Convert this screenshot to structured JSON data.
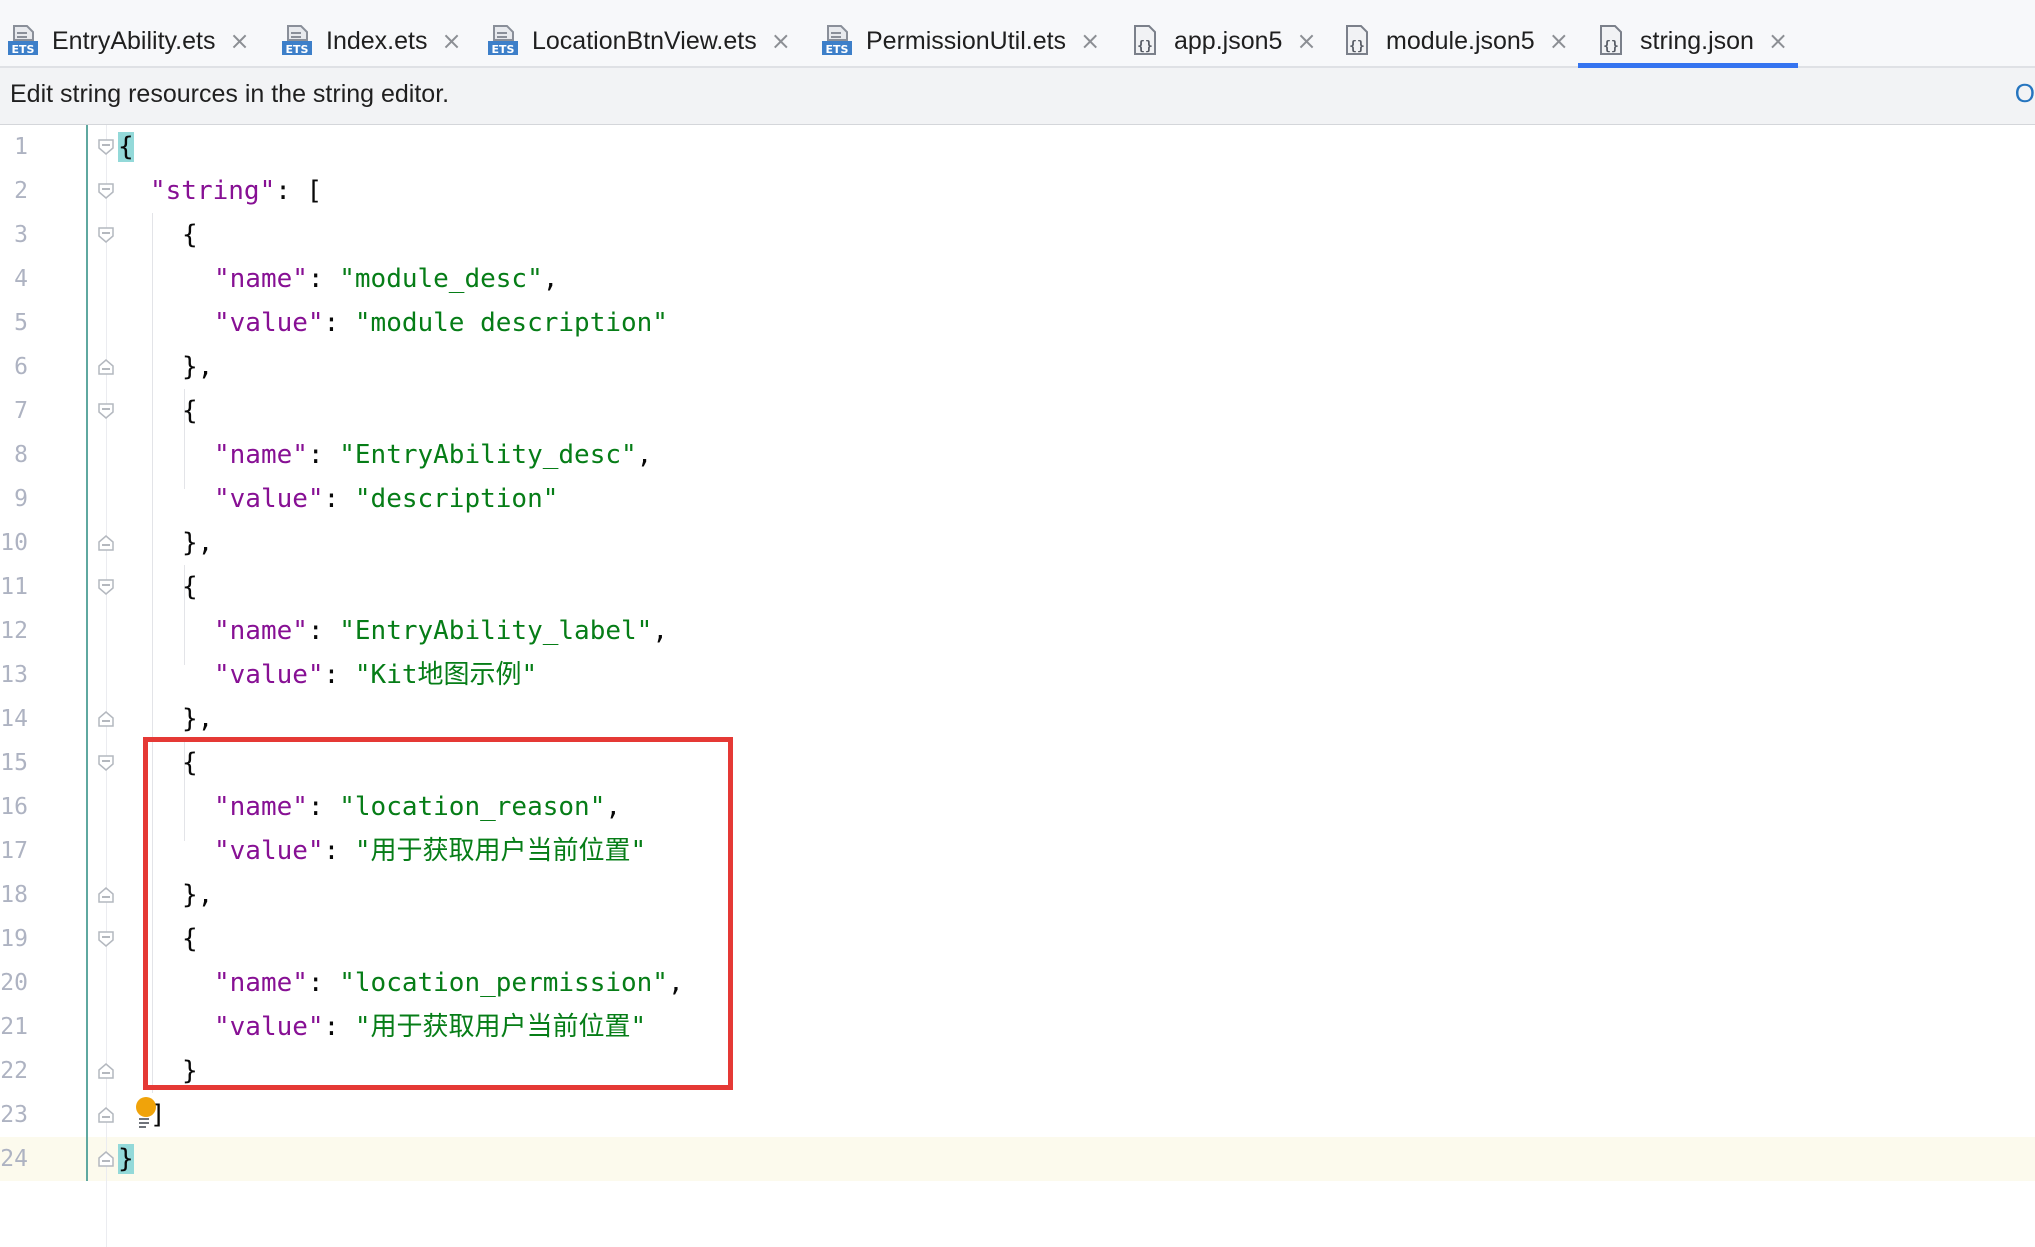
{
  "tabs": [
    {
      "label": "EntryAbility.ets",
      "icon": "ets-file-icon",
      "active": false
    },
    {
      "label": "Index.ets",
      "icon": "ets-file-icon",
      "active": false
    },
    {
      "label": "LocationBtnView.ets",
      "icon": "ets-file-icon",
      "active": false
    },
    {
      "label": "PermissionUtil.ets",
      "icon": "ets-file-icon",
      "active": false
    },
    {
      "label": "app.json5",
      "icon": "json-file-icon",
      "active": false
    },
    {
      "label": "module.json5",
      "icon": "json-file-icon",
      "active": false
    },
    {
      "label": "string.json",
      "icon": "json-file-icon",
      "active": true
    }
  ],
  "close_glyph": "×",
  "notice": {
    "text": "Edit string resources in the string editor.",
    "link": "O"
  },
  "line_numbers": [
    "1",
    "2",
    "3",
    "4",
    "5",
    "6",
    "7",
    "8",
    "9",
    "10",
    "11",
    "12",
    "13",
    "14",
    "15",
    "16",
    "17",
    "18",
    "19",
    "20",
    "21",
    "22",
    "23",
    "24"
  ],
  "code": {
    "l1_brace": "{",
    "l2_key": "\"string\"",
    "l2_rest": ": [",
    "l3": "{",
    "l4_key": "\"name\"",
    "l4_val": "\"module_desc\"",
    "l5_key": "\"value\"",
    "l5_val": "\"module description\"",
    "l6": "},",
    "l7": "{",
    "l8_key": "\"name\"",
    "l8_val": "\"EntryAbility_desc\"",
    "l9_key": "\"value\"",
    "l9_val": "\"description\"",
    "l10": "},",
    "l11": "{",
    "l12_key": "\"name\"",
    "l12_val": "\"EntryAbility_label\"",
    "l13_key": "\"value\"",
    "l13_val": "\"Kit地图示例\"",
    "l14": "},",
    "l15": "{",
    "l16_key": "\"name\"",
    "l16_val": "\"location_reason\"",
    "l17_key": "\"value\"",
    "l17_val": "\"用于获取用户当前位置\"",
    "l18": "},",
    "l19": "{",
    "l20_key": "\"name\"",
    "l20_val": "\"location_permission\"",
    "l21_key": "\"value\"",
    "l21_val": "\"用于获取用户当前位置\"",
    "l22": "}",
    "l23": "]",
    "l24_brace": "}",
    "colon": ": ",
    "comma": ","
  },
  "colors": {
    "key": "#871094",
    "string": "#067d17",
    "highlight_box": "#e53935",
    "active_tab_underline": "#3574f0"
  }
}
